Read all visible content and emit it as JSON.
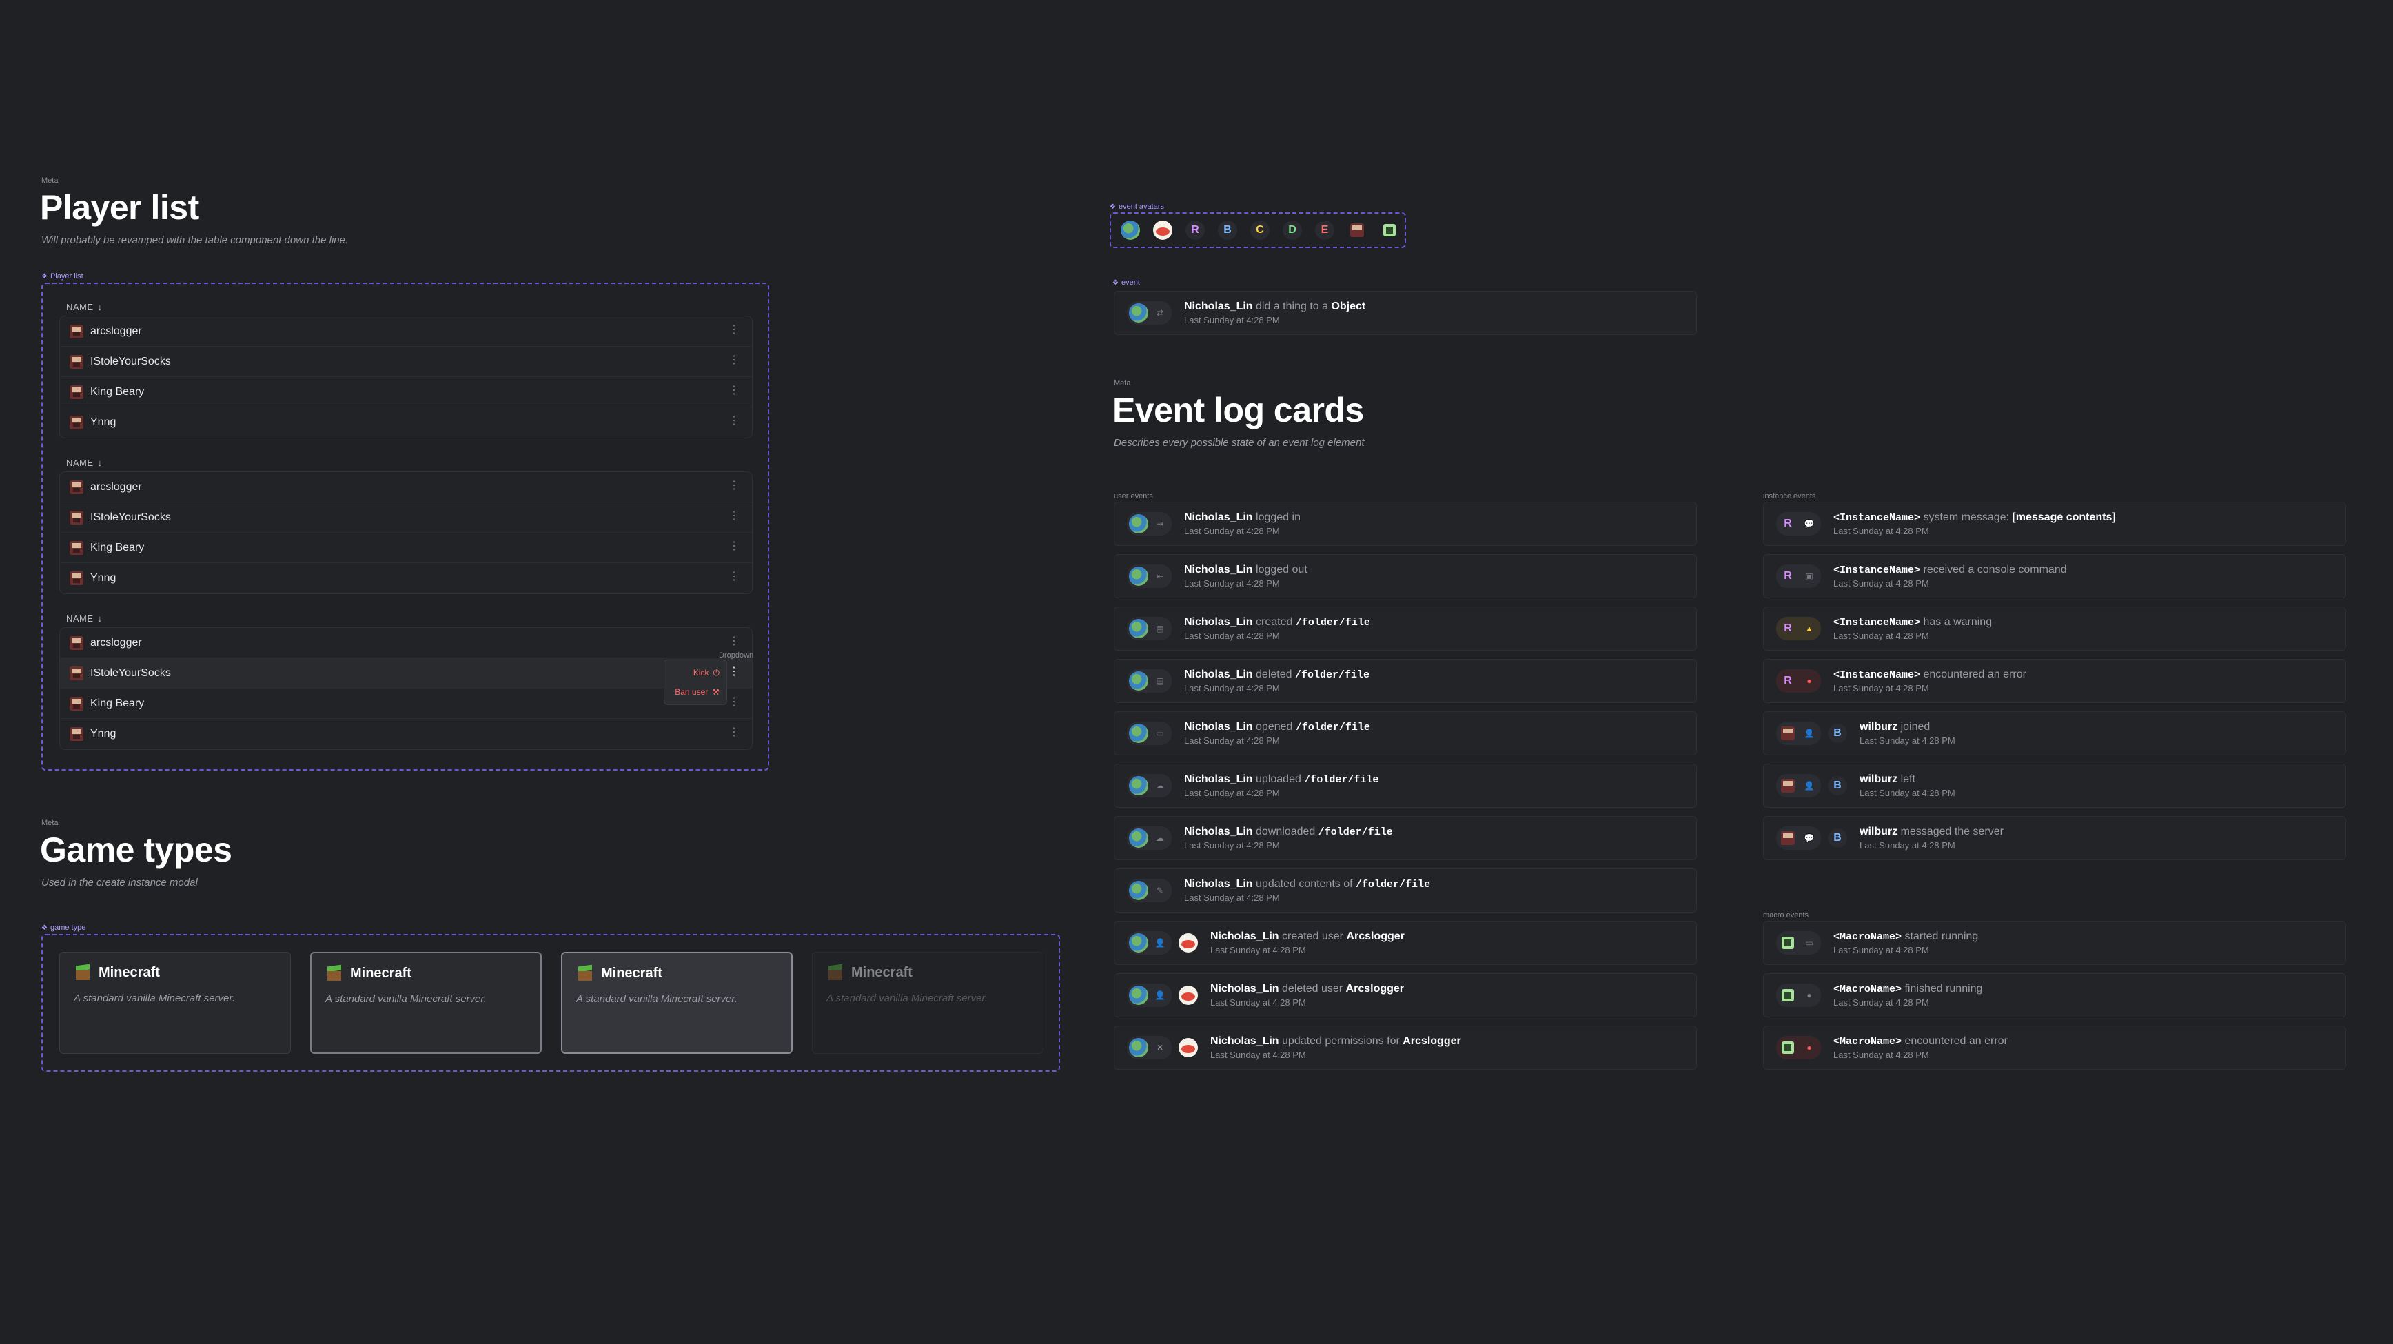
{
  "player_section": {
    "meta": "Meta",
    "title": "Player list",
    "subtitle": "Will probably be revamped with the table component down the line.",
    "tag": "Player list",
    "header": "NAME",
    "players": [
      "arcslogger",
      "IStoleYourSocks",
      "King Beary",
      "Ynng"
    ],
    "dropdown": {
      "label": "Dropdown",
      "kick": "Kick",
      "ban": "Ban user"
    }
  },
  "game_section": {
    "meta": "Meta",
    "title": "Game types",
    "subtitle": "Used in the create instance modal",
    "tag": "game type",
    "cards": [
      {
        "name": "Minecraft",
        "desc": "A standard vanilla Minecraft server."
      },
      {
        "name": "Minecraft",
        "desc": "A standard vanilla Minecraft server."
      },
      {
        "name": "Minecraft",
        "desc": "A standard vanilla Minecraft server."
      },
      {
        "name": "Minecraft",
        "desc": "A standard vanilla Minecraft server."
      }
    ]
  },
  "avatars": {
    "tag": "event avatars",
    "letters": [
      {
        "t": "R",
        "c": "#d68cff"
      },
      {
        "t": "B",
        "c": "#7ab8ff"
      },
      {
        "t": "C",
        "c": "#ffd24a"
      },
      {
        "t": "D",
        "c": "#7de08a"
      },
      {
        "t": "E",
        "c": "#ff6b6b"
      }
    ]
  },
  "event_single": {
    "tag": "event",
    "user": "Nicholas_Lin",
    "action": "did a thing to a",
    "object": "Object",
    "time": "Last Sunday at 4:28 PM"
  },
  "event_log": {
    "meta": "Meta",
    "title": "Event log cards",
    "subtitle": "Describes every possible state of an event log element",
    "user_label": "user events",
    "instance_label": "instance events",
    "macro_label": "macro events"
  },
  "user_events": [
    {
      "user": "Nicholas_Lin",
      "action": "logged in",
      "obj": "",
      "time": "Last Sunday at 4:28 PM",
      "icon": "⇥"
    },
    {
      "user": "Nicholas_Lin",
      "action": "logged out",
      "obj": "",
      "time": "Last Sunday at 4:28 PM",
      "icon": "⇤"
    },
    {
      "user": "Nicholas_Lin",
      "action": "created",
      "obj": "/folder/file",
      "time": "Last Sunday at 4:28 PM",
      "icon": "▤"
    },
    {
      "user": "Nicholas_Lin",
      "action": "deleted",
      "obj": "/folder/file",
      "time": "Last Sunday at 4:28 PM",
      "icon": "▤"
    },
    {
      "user": "Nicholas_Lin",
      "action": "opened",
      "obj": "/folder/file",
      "time": "Last Sunday at 4:28 PM",
      "icon": "▭"
    },
    {
      "user": "Nicholas_Lin",
      "action": "uploaded",
      "obj": "/folder/file",
      "time": "Last Sunday at 4:28 PM",
      "icon": "☁"
    },
    {
      "user": "Nicholas_Lin",
      "action": "downloaded",
      "obj": "/folder/file",
      "time": "Last Sunday at 4:28 PM",
      "icon": "☁"
    },
    {
      "user": "Nicholas_Lin",
      "action": "updated contents of",
      "obj": "/folder/file",
      "time": "Last Sunday at 4:28 PM",
      "icon": "✎"
    }
  ],
  "user_target_events": [
    {
      "user": "Nicholas_Lin",
      "action": "created user",
      "obj": "Arcslogger",
      "time": "Last Sunday at 4:28 PM",
      "icon": "👤",
      "ic": "#7de08a"
    },
    {
      "user": "Nicholas_Lin",
      "action": "deleted user",
      "obj": "Arcslogger",
      "time": "Last Sunday at 4:28 PM",
      "icon": "👤",
      "ic": "#ff6b6b"
    },
    {
      "user": "Nicholas_Lin",
      "action": "updated permissions for",
      "obj": "Arcslogger",
      "time": "Last Sunday at 4:28 PM",
      "icon": "✕",
      "ic": "#9a9ca3"
    }
  ],
  "instance_events": [
    {
      "name": "<InstanceName>",
      "action": "system message:",
      "obj": "[message contents]",
      "time": "Last Sunday at 4:28 PM",
      "icon": "💬",
      "ic": "#7a7c83",
      "bg": "#2c2d32"
    },
    {
      "name": "<InstanceName>",
      "action": "received a console command",
      "obj": "",
      "time": "Last Sunday at 4:28 PM",
      "icon": "▣",
      "ic": "#7a7c83",
      "bg": "#2c2d32"
    },
    {
      "name": "<InstanceName>",
      "action": "has a warning",
      "obj": "",
      "time": "Last Sunday at 4:28 PM",
      "icon": "▲",
      "ic": "#ffd24a",
      "bg": "#3a3526"
    },
    {
      "name": "<InstanceName>",
      "action": "encountered an error",
      "obj": "",
      "time": "Last Sunday at 4:28 PM",
      "icon": "●",
      "ic": "#ff5555",
      "bg": "#3a2628"
    }
  ],
  "instance_user_events": [
    {
      "user": "wilburz",
      "action": "joined",
      "time": "Last Sunday at 4:28 PM",
      "icon": "👤",
      "ic": "#7de08a"
    },
    {
      "user": "wilburz",
      "action": "left",
      "time": "Last Sunday at 4:28 PM",
      "icon": "👤",
      "ic": "#ff6b6b"
    },
    {
      "user": "wilburz",
      "action": "messaged the server",
      "time": "Last Sunday at 4:28 PM",
      "icon": "💬",
      "ic": "#7a7c83"
    }
  ],
  "macro_events": [
    {
      "name": "<MacroName>",
      "action": "started running",
      "time": "Last Sunday at 4:28 PM",
      "icon": "▭",
      "ic": "#7a7c83",
      "bg": "#2c2d32"
    },
    {
      "name": "<MacroName>",
      "action": "finished running",
      "time": "Last Sunday at 4:28 PM",
      "icon": "●",
      "ic": "#7a7c83",
      "bg": "#2c2d32"
    },
    {
      "name": "<MacroName>",
      "action": "encountered an error",
      "time": "Last Sunday at 4:28 PM",
      "icon": "●",
      "ic": "#ff5555",
      "bg": "#3a2628"
    }
  ]
}
